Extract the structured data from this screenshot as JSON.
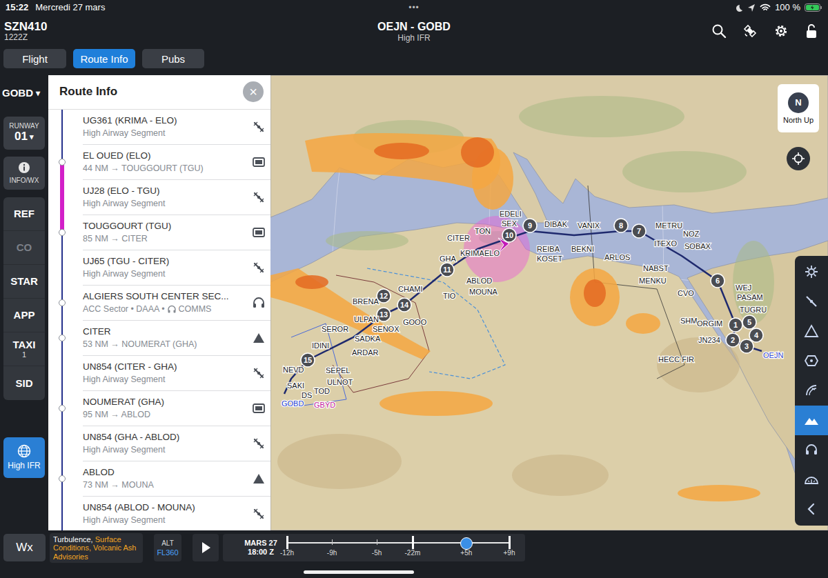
{
  "status_bar": {
    "time": "15:22",
    "date": "Mercredi 27 mars",
    "dots": "•••",
    "battery": "100 %"
  },
  "header": {
    "callsign": "SZN410",
    "zulu": "1222Z",
    "route": "OEJN - GOBD",
    "chart": "High IFR"
  },
  "tabs": [
    {
      "label": "Flight",
      "selected": false
    },
    {
      "label": "Route Info",
      "selected": true
    },
    {
      "label": "Pubs",
      "selected": false
    }
  ],
  "sidebar": {
    "airport": "GOBD",
    "airport_caret": "▾",
    "runway_label": "RUNWAY",
    "runway": "01",
    "runway_caret": "▾",
    "info": "INFO/WX",
    "items": [
      {
        "label": "REF",
        "sub": "",
        "disabled": false
      },
      {
        "label": "CO",
        "sub": "",
        "disabled": true
      },
      {
        "label": "STAR",
        "sub": "",
        "disabled": false
      },
      {
        "label": "APP",
        "sub": "",
        "disabled": false
      },
      {
        "label": "TAXI",
        "sub": "1",
        "disabled": false
      },
      {
        "label": "SID",
        "sub": "",
        "disabled": false
      }
    ],
    "chart_button": {
      "label": "High IFR",
      "selected": true
    }
  },
  "route_info": {
    "title": "Route Info",
    "close": "×",
    "rows": [
      {
        "title": "UG361 (KRIMA - ELO)",
        "subtitle": "High Airway Segment",
        "kind": "airway",
        "node": false,
        "active": false
      },
      {
        "title": "EL OUED (ELO)",
        "subtitle": "44 NM → TOUGGOURT (TGU)",
        "kind": "vor",
        "node": true,
        "active": false
      },
      {
        "title": "UJ28 (ELO - TGU)",
        "subtitle": "High Airway Segment",
        "kind": "airway",
        "node": false,
        "active": true
      },
      {
        "title": "TOUGGOURT (TGU)",
        "subtitle": "85 NM → CITER",
        "kind": "vor",
        "node": true,
        "active": false
      },
      {
        "title": "UJ65 (TGU - CITER)",
        "subtitle": "High Airway Segment",
        "kind": "airway",
        "node": false,
        "active": false
      },
      {
        "title": "ALGIERS SOUTH CENTER SEC...",
        "subtitle": "ACC Sector • DAAA •",
        "comms": "COMMS",
        "kind": "sector",
        "node": true,
        "active": false
      },
      {
        "title": "CITER",
        "subtitle": "53 NM → NOUMERAT (GHA)",
        "kind": "fix",
        "node": true,
        "active": false
      },
      {
        "title": "UN854 (CITER - GHA)",
        "subtitle": "High Airway Segment",
        "kind": "airway",
        "node": false,
        "active": false
      },
      {
        "title": "NOUMERAT (GHA)",
        "subtitle": "95 NM → ABLOD",
        "kind": "vor",
        "node": true,
        "active": false
      },
      {
        "title": "UN854 (GHA - ABLOD)",
        "subtitle": "High Airway Segment",
        "kind": "airway",
        "node": false,
        "active": false
      },
      {
        "title": "ABLOD",
        "subtitle": "73 NM → MOUNA",
        "kind": "fix",
        "node": true,
        "active": false
      },
      {
        "title": "UN854 (ABLOD - MOUNA)",
        "subtitle": "High Airway Segment",
        "kind": "airway",
        "node": false,
        "active": false
      }
    ]
  },
  "map": {
    "compass": {
      "letter": "N",
      "label": "North Up"
    },
    "waypoints": [
      {
        "label": "1"
      },
      {
        "label": "2"
      },
      {
        "label": "3"
      },
      {
        "label": "4"
      },
      {
        "label": "5"
      },
      {
        "label": "6"
      },
      {
        "label": "7"
      },
      {
        "label": "8"
      },
      {
        "label": "9"
      },
      {
        "label": "10"
      },
      {
        "label": "11"
      },
      {
        "label": "12"
      },
      {
        "label": "13"
      },
      {
        "label": "14"
      },
      {
        "label": "15"
      }
    ],
    "labels": [
      {
        "text": "CITER",
        "color": "#1a1a1a"
      },
      {
        "text": "KRIMA",
        "color": "#1a1a1a"
      },
      {
        "text": "GHA",
        "color": "#1a1a1a"
      },
      {
        "text": "TIO",
        "color": "#1a1a1a"
      },
      {
        "text": "MOUNA",
        "color": "#1a1a1a"
      },
      {
        "text": "ABLOD",
        "color": "#1a1a1a"
      },
      {
        "text": "CHAMI",
        "color": "#1a1a1a"
      },
      {
        "text": "BRENA",
        "color": "#1a1a1a"
      },
      {
        "text": "ULPAN",
        "color": "#1a1a1a"
      },
      {
        "text": "SEROR",
        "color": "#1a1a1a"
      },
      {
        "text": "SENOX",
        "color": "#1a1a1a"
      },
      {
        "text": "SADKA",
        "color": "#1a1a1a"
      },
      {
        "text": "GOOO",
        "color": "#1a1a1a"
      },
      {
        "text": "IDINI",
        "color": "#1a1a1a"
      },
      {
        "text": "ARDAR",
        "color": "#1a1a1a"
      },
      {
        "text": "SEPEL",
        "color": "#1a1a1a"
      },
      {
        "text": "ULNOT",
        "color": "#1a1a1a"
      },
      {
        "text": "NEVD",
        "color": "#1a1a1a"
      },
      {
        "text": "TOD",
        "color": "#1a1a1a"
      },
      {
        "text": "SAKI",
        "color": "#1a1a1a"
      },
      {
        "text": "DS",
        "color": "#1a1a1a"
      },
      {
        "text": "GOBD",
        "color": "#1f3fd0"
      },
      {
        "text": "GBYD",
        "color": "#c21a9c"
      },
      {
        "text": "EDELI",
        "color": "#1a1a1a"
      },
      {
        "text": "DIBAK",
        "color": "#1a1a1a"
      },
      {
        "text": "VANIX",
        "color": "#1a1a1a"
      },
      {
        "text": "REIBA",
        "color": "#1a1a1a"
      },
      {
        "text": "KOSET",
        "color": "#1a1a1a"
      },
      {
        "text": "BEKNI",
        "color": "#1a1a1a"
      },
      {
        "text": "ARLOS",
        "color": "#1a1a1a"
      },
      {
        "text": "METRU",
        "color": "#1a1a1a"
      },
      {
        "text": "ITEXO",
        "color": "#1a1a1a"
      },
      {
        "text": "NOZ",
        "color": "#1a1a1a"
      },
      {
        "text": "SOBAX",
        "color": "#1a1a1a"
      },
      {
        "text": "NABST",
        "color": "#1a1a1a"
      },
      {
        "text": "MENKU",
        "color": "#1a1a1a"
      },
      {
        "text": "CVO",
        "color": "#1a1a1a"
      },
      {
        "text": "SHM",
        "color": "#1a1a1a"
      },
      {
        "text": "ORGIM",
        "color": "#1a1a1a"
      },
      {
        "text": "PASAM",
        "color": "#1a1a1a"
      },
      {
        "text": "WEJ",
        "color": "#1a1a1a"
      },
      {
        "text": "TUGRU",
        "color": "#1a1a1a"
      },
      {
        "text": "JN234",
        "color": "#1a1a1a"
      },
      {
        "text": "OEJN",
        "color": "#3a4ad0"
      },
      {
        "text": "HECC FIR",
        "color": "#1a1a1a"
      },
      {
        "text": "TON",
        "color": "#1a1a1a"
      },
      {
        "text": "SEX",
        "color": "#1a1a1a"
      },
      {
        "text": "ELO",
        "color": "#1a1a1a"
      }
    ],
    "tools": [
      {
        "selected": false
      },
      {
        "selected": false
      },
      {
        "selected": false
      },
      {
        "selected": false
      },
      {
        "selected": false
      },
      {
        "selected": true
      },
      {
        "selected": false
      },
      {
        "selected": false
      },
      {
        "selected": false
      }
    ]
  },
  "bottom": {
    "wx": "Wx",
    "layers": [
      {
        "text": "Turbulence, ",
        "color": "#ffffff"
      },
      {
        "text": "Surface Conditions, ",
        "color": "#f5a623"
      },
      {
        "text": "Volcanic Ash Advisories",
        "color": "#f5a623"
      }
    ],
    "alt_label": "ALT",
    "alt": "FL360",
    "date": "MARS 27",
    "time": "18:00 Z",
    "ticks": [
      "-12h",
      "-9h",
      "-5h",
      "-22m",
      "+5h",
      "+9h"
    ],
    "level": 0.807
  }
}
